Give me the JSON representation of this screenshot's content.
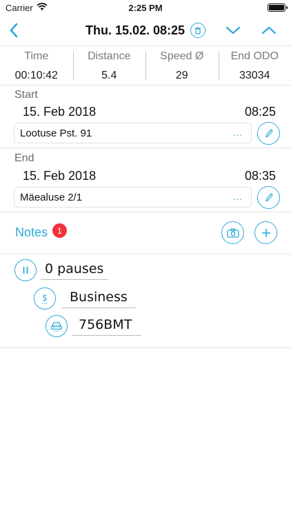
{
  "status_bar": {
    "carrier": "Carrier",
    "time": "2:25 PM"
  },
  "nav": {
    "title": "Thu. 15.02. 08:25"
  },
  "stats": [
    {
      "label": "Time",
      "value": "00:10:42"
    },
    {
      "label": "Distance",
      "value": "5.4"
    },
    {
      "label": "Speed Ø",
      "value": "29"
    },
    {
      "label": "End ODO",
      "value": "33034"
    }
  ],
  "start": {
    "label": "Start",
    "date": "15. Feb 2018",
    "time": "08:25",
    "address": "Lootuse Pst. 91",
    "more": "..."
  },
  "end": {
    "label": "End",
    "date": "15. Feb 2018",
    "time": "08:35",
    "address": "Mäealuse 2/1",
    "more": "..."
  },
  "notes": {
    "label": "Notes",
    "badge": "1"
  },
  "meta": {
    "pauses": "0 pauses",
    "category": "Business",
    "vehicle": "756BMT"
  },
  "colors": {
    "accent": "#2aa9d9",
    "badge": "#f2333d"
  }
}
